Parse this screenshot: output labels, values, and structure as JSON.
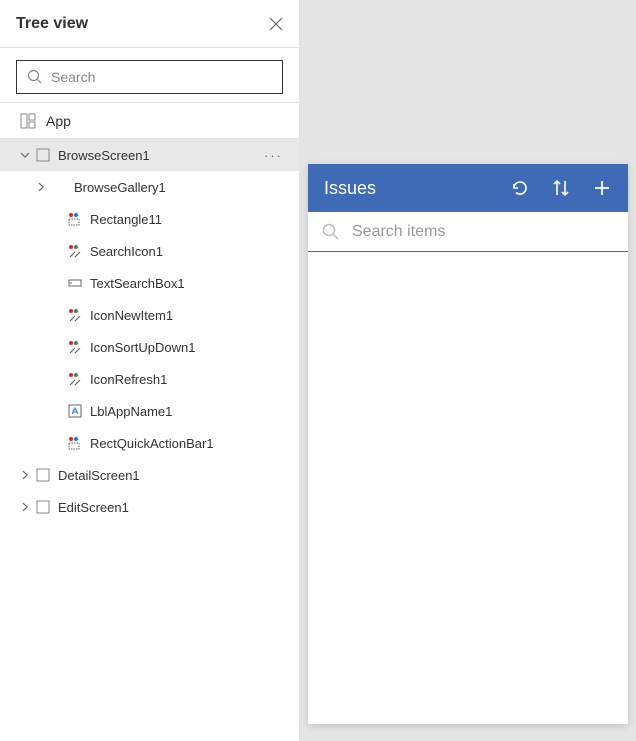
{
  "panel": {
    "title": "Tree view",
    "searchPlaceholder": "Search",
    "app": "App",
    "screens": {
      "browse": "BrowseScreen1",
      "detail": "DetailScreen1",
      "edit": "EditScreen1"
    },
    "browseChildren": {
      "gallery": "BrowseGallery1",
      "rect11": "Rectangle11",
      "search": "SearchIcon1",
      "textbox": "TextSearchBox1",
      "newitem": "IconNewItem1",
      "sort": "IconSortUpDown1",
      "refresh": "IconRefresh1",
      "lblapp": "LblAppName1",
      "rectqa": "RectQuickActionBar1"
    }
  },
  "preview": {
    "title": "Issues",
    "searchPlaceholder": "Search items"
  },
  "colors": {
    "headerBlue": "#3f6ab5"
  }
}
